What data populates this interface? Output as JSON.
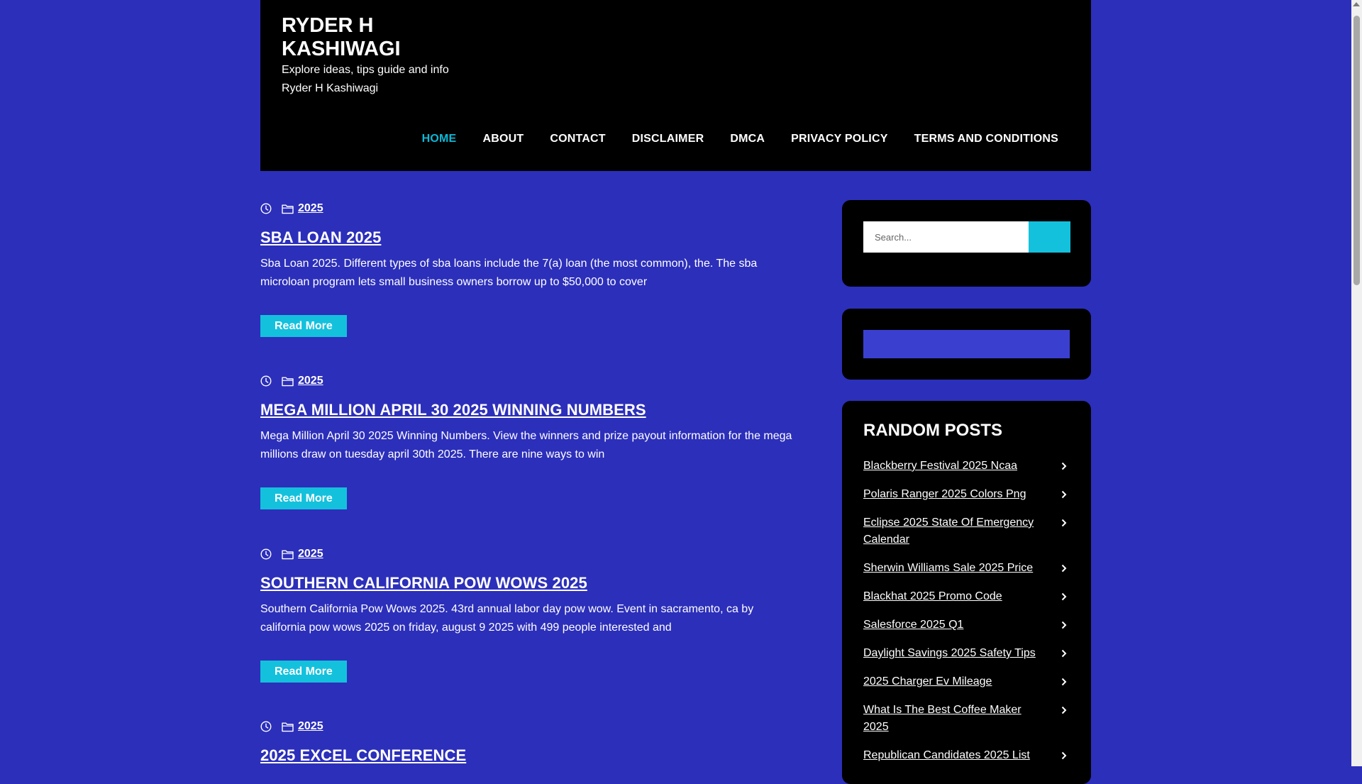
{
  "site": {
    "title": "RYDER H KASHIWAGI",
    "tagline": "Explore ideas, tips guide and info Ryder H Kashiwagi"
  },
  "nav": {
    "items": [
      {
        "label": "HOME",
        "active": true
      },
      {
        "label": "ABOUT"
      },
      {
        "label": "CONTACT"
      },
      {
        "label": "DISCLAIMER"
      },
      {
        "label": "DMCA"
      },
      {
        "label": "PRIVACY POLICY"
      },
      {
        "label": "TERMS AND CONDITIONS"
      }
    ]
  },
  "posts": [
    {
      "category": "2025",
      "title": "SBA LOAN 2025",
      "excerpt": "Sba Loan 2025. Different types of sba loans include the 7(a) loan (the most common), the. The sba microloan program lets small business owners borrow up to $50,000 to cover",
      "read_more": "Read More"
    },
    {
      "category": "2025",
      "title": "MEGA MILLION APRIL 30 2025 WINNING NUMBERS",
      "excerpt": "Mega Million April 30 2025 Winning Numbers. View the winners and prize payout information for the mega millions draw on tuesday april 30th 2025. There are nine ways to win",
      "read_more": "Read More"
    },
    {
      "category": "2025",
      "title": "SOUTHERN CALIFORNIA POW WOWS 2025",
      "excerpt": "Southern California Pow Wows 2025. 43rd annual labor day pow wow. Event in sacramento, ca by california pow wows 2025 on friday, august 9 2025 with 499 people interested and",
      "read_more": "Read More"
    },
    {
      "category": "2025",
      "title": "2025 EXCEL CONFERENCE"
    }
  ],
  "sidebar": {
    "search": {
      "placeholder": "Search..."
    },
    "random_posts": {
      "title": "RANDOM POSTS",
      "items": [
        "Blackberry Festival 2025 Ncaa",
        "Polaris Ranger 2025 Colors Png",
        "Eclipse 2025 State Of Emergency Calendar",
        "Sherwin Williams Sale 2025 Price",
        "Blackhat 2025 Promo Code",
        "Salesforce 2025 Q1",
        "Daylight Savings 2025 Safety Tips",
        "2025 Charger Ev Mileage",
        "What Is The Best Coffee Maker 2025",
        "Republican Candidates 2025 List"
      ]
    }
  },
  "colors": {
    "background": "#2c2fba",
    "header": "#000000",
    "accent": "#13c1dd",
    "nav_active": "#0bb8d6"
  }
}
